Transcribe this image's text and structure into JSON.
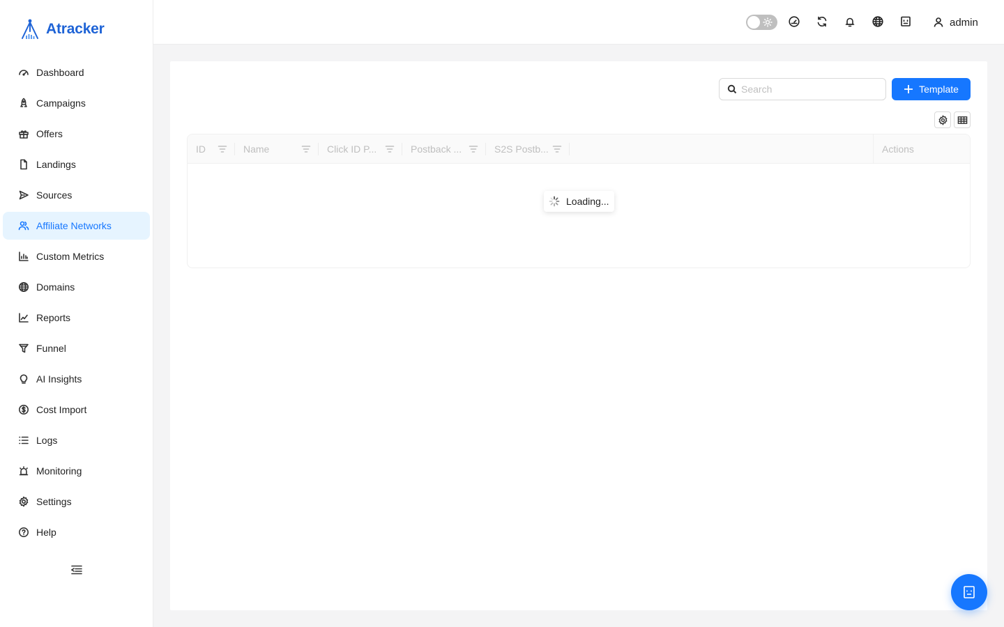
{
  "app": {
    "name": "Atracker",
    "brand_color": "#1e63d6",
    "accent": "#1677ff"
  },
  "sidebar": {
    "items": [
      {
        "label": "Dashboard",
        "icon": "dashboard-icon",
        "active": false
      },
      {
        "label": "Campaigns",
        "icon": "rocket-icon",
        "active": false
      },
      {
        "label": "Offers",
        "icon": "gift-icon",
        "active": false
      },
      {
        "label": "Landings",
        "icon": "file-icon",
        "active": false
      },
      {
        "label": "Sources",
        "icon": "send-icon",
        "active": false
      },
      {
        "label": "Affiliate Networks",
        "icon": "users-icon",
        "active": true
      },
      {
        "label": "Custom Metrics",
        "icon": "bar-chart-icon",
        "active": false
      },
      {
        "label": "Domains",
        "icon": "globe-icon",
        "active": false
      },
      {
        "label": "Reports",
        "icon": "line-chart-icon",
        "active": false
      },
      {
        "label": "Funnel",
        "icon": "funnel-icon",
        "active": false
      },
      {
        "label": "AI Insights",
        "icon": "bulb-icon",
        "active": false
      },
      {
        "label": "Cost Import",
        "icon": "dollar-icon",
        "active": false
      },
      {
        "label": "Logs",
        "icon": "list-icon",
        "active": false
      },
      {
        "label": "Monitoring",
        "icon": "alarm-icon",
        "active": false
      },
      {
        "label": "Settings",
        "icon": "gear-icon",
        "active": false
      },
      {
        "label": "Help",
        "icon": "help-icon",
        "active": false
      }
    ],
    "collapse_icon": "menu-fold-icon"
  },
  "header": {
    "theme_toggle": {
      "checked": false,
      "icon": "sun-icon"
    },
    "icons": [
      "dashboard-icon",
      "refresh-icon",
      "bell-icon",
      "globe-icon",
      "robot-icon"
    ],
    "user": {
      "name": "admin",
      "icon": "user-icon"
    }
  },
  "toolbar": {
    "search_placeholder": "Search",
    "search_value": "",
    "add_button_label": "Template",
    "settings_icon": "gear-icon",
    "density_icon": "table-icon"
  },
  "table": {
    "columns": [
      {
        "label": "ID",
        "filterable": true
      },
      {
        "label": "Name",
        "filterable": true
      },
      {
        "label": "Click ID P...",
        "filterable": true
      },
      {
        "label": "Postback ...",
        "filterable": true
      },
      {
        "label": "S2S Postb...",
        "filterable": true
      },
      {
        "label": "Actions",
        "filterable": false
      }
    ],
    "rows": [],
    "loading_text": "Loading..."
  },
  "fab": {
    "icon": "robot-icon"
  }
}
